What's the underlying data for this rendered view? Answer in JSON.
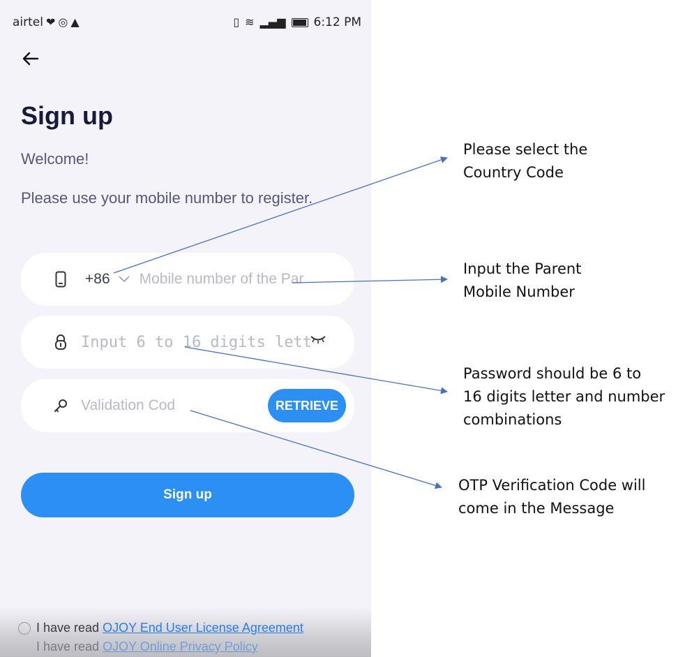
{
  "status_bar": {
    "carrier": "airtel",
    "time": "6:12 PM"
  },
  "page": {
    "title": "Sign up",
    "welcome": "Welcome!",
    "instruction": "Please use your mobile number to register."
  },
  "form": {
    "country_code": "+86",
    "mobile_placeholder": "Mobile number of the Par",
    "password_placeholder": "Input 6 to 16 digits lett",
    "code_placeholder": "Validation Cod",
    "retrieve_label": "RETRIEVE",
    "signup_label": "Sign up"
  },
  "agreement": {
    "prefix": "I have read ",
    "link_1": "OJOY End User License Agreement",
    "link_2": "OJOY Online Privacy Policy"
  },
  "annotations": {
    "country_code_line1": "Please select the",
    "country_code_line2": "Country Code",
    "mobile_line1": "Input the Parent",
    "mobile_line2": "Mobile Number",
    "password_line1": "Password should be 6 to",
    "password_line2": "16 digits letter and number",
    "password_line3": "combinations",
    "otp_line1": "OTP Verification Code will",
    "otp_line2": "come in the Message"
  },
  "colors": {
    "primary": "#2b8ff4",
    "background": "#f4f3fa",
    "arrow": "#4472c4"
  },
  "icons": {
    "back": "arrow-left-icon",
    "phone": "mobile-phone-icon",
    "lock": "lock-icon",
    "key": "key-icon",
    "eye": "eye-closed-icon"
  }
}
